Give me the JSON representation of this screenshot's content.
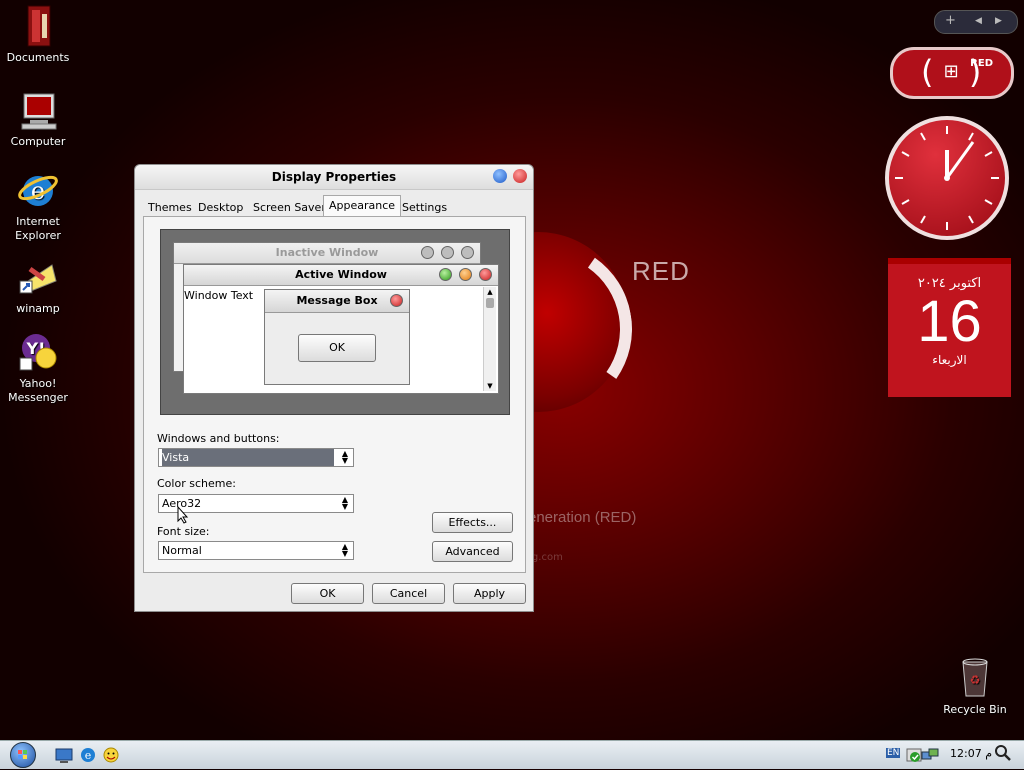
{
  "desktop": {
    "wallpaper_text": "RED",
    "wallpaper_subtext": "eneration (RED)",
    "wallpaper_small": "rg.com",
    "icons": [
      {
        "label": "Documents",
        "icon": "folder-icon"
      },
      {
        "label": "Computer",
        "icon": "computer-icon"
      },
      {
        "label": "Internet\nExplorer",
        "icon": "internet-explorer-icon"
      },
      {
        "label": "winamp",
        "icon": "winamp-icon"
      },
      {
        "label": "Yahoo!\nMessenger",
        "icon": "yahoo-messenger-icon"
      }
    ],
    "recycle_bin": "Recycle Bin"
  },
  "gadgets": {
    "toolbar_plus": "+",
    "toolbar_prev": "◀",
    "toolbar_next": "▶",
    "badge_label": "RED",
    "calendar": {
      "month_year": "اكتوبر ٢٠٢٤",
      "day": "16",
      "weekday": "الاربعاء"
    }
  },
  "dialog": {
    "title": "Display Properties",
    "tabs": [
      "Themes",
      "Desktop",
      "Screen Saver",
      "Appearance",
      "Settings"
    ],
    "active_tab": "Appearance",
    "preview": {
      "inactive_title": "Inactive Window",
      "active_title": "Active Window",
      "window_text": "Window Text",
      "message_title": "Message Box",
      "message_ok": "OK"
    },
    "windows_buttons_label": "Windows and buttons:",
    "windows_buttons_value": "Vista",
    "color_scheme_label": "Color scheme:",
    "color_scheme_value": "Aero32",
    "font_size_label": "Font size:",
    "font_size_value": "Normal",
    "effects_button": "Effects...",
    "advanced_button": "Advanced",
    "ok_button": "OK",
    "cancel_button": "Cancel",
    "apply_button": "Apply"
  },
  "taskbar": {
    "language": "EN",
    "clock": "12:07 م"
  },
  "colors": {
    "accent_red": "#c0141e",
    "dialog_bg": "#ececec"
  }
}
